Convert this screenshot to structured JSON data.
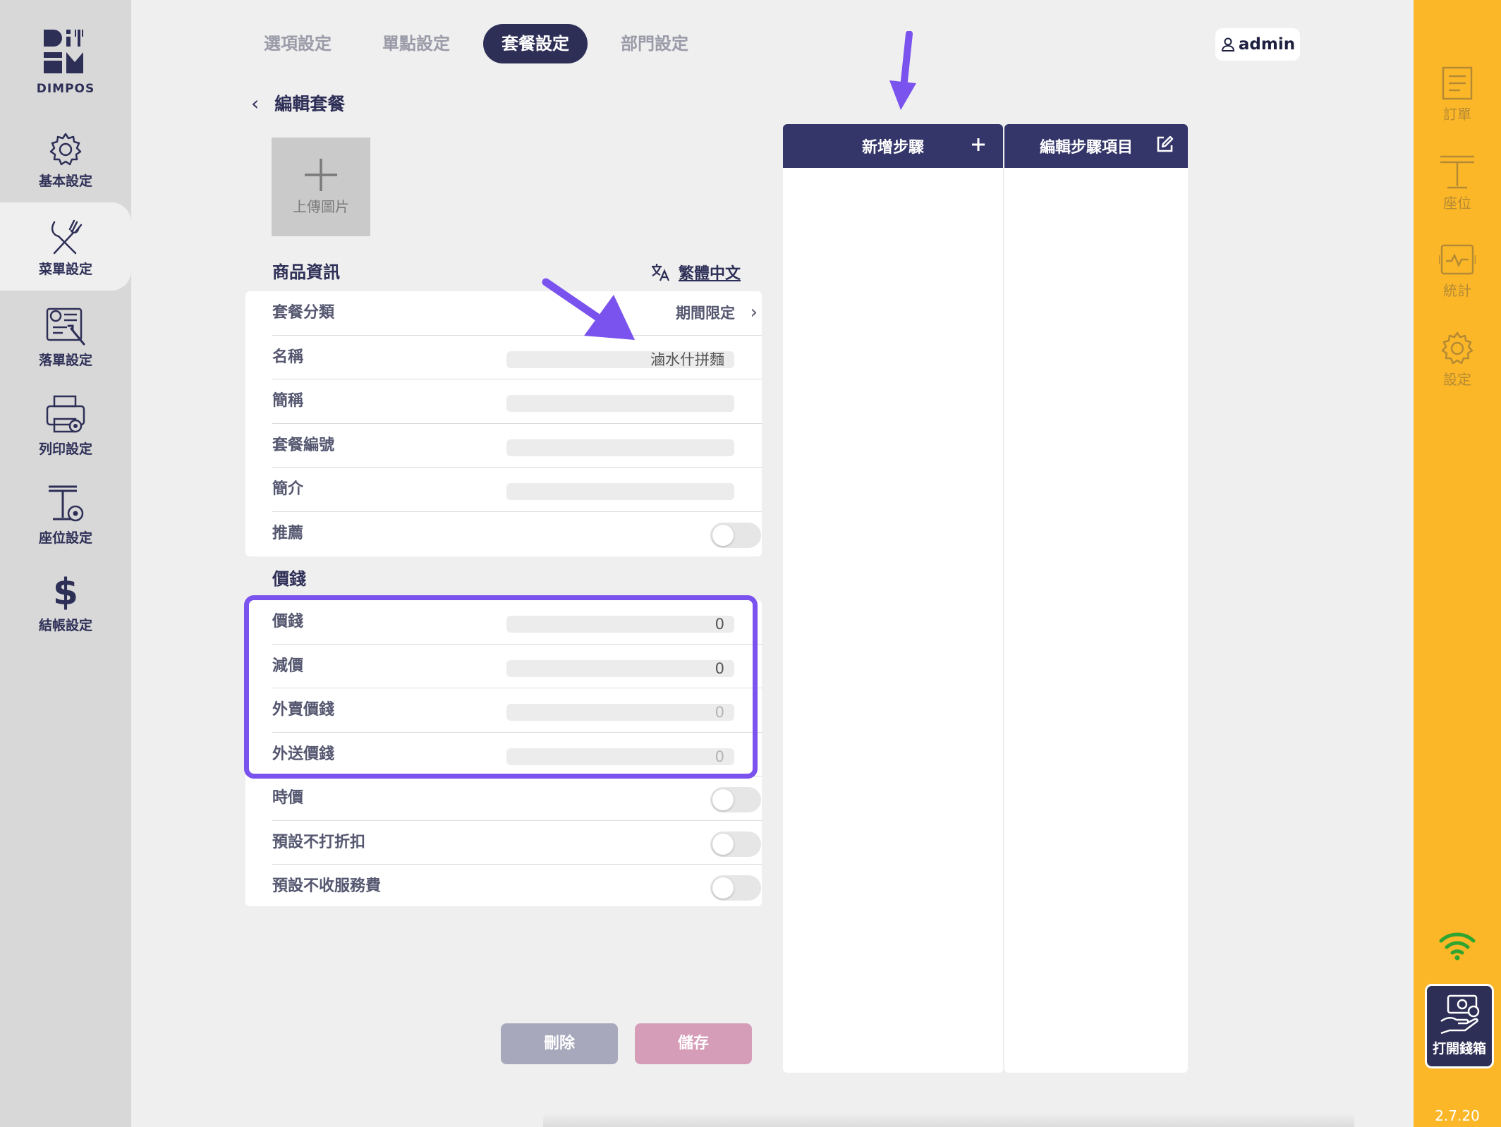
{
  "app": {
    "logo_text": "DIMPOS",
    "version": "2.7.20"
  },
  "left_sidebar": {
    "items": [
      {
        "label": "基本設定",
        "icon": "gear-icon"
      },
      {
        "label": "菜單設定",
        "icon": "fork-knife-icon",
        "active": true
      },
      {
        "label": "落單設定",
        "icon": "order-settings-icon"
      },
      {
        "label": "列印設定",
        "icon": "printer-icon"
      },
      {
        "label": "座位設定",
        "icon": "table-settings-icon"
      },
      {
        "label": "結帳設定",
        "icon": "dollar-icon"
      }
    ]
  },
  "tabs": [
    {
      "label": "選項設定"
    },
    {
      "label": "單點設定"
    },
    {
      "label": "套餐設定",
      "active": true
    },
    {
      "label": "部門設定"
    }
  ],
  "user": {
    "name": "admin"
  },
  "page": {
    "title": "編輯套餐",
    "upload_label": "上傳圖片",
    "product_section_title": "商品資訊",
    "language": "繁體中文"
  },
  "product_info": {
    "category": {
      "label": "套餐分類",
      "value": "期間限定"
    },
    "name": {
      "label": "名稱",
      "value": "滷水什拼麵"
    },
    "short_name": {
      "label": "簡稱",
      "value": ""
    },
    "code": {
      "label": "套餐編號",
      "value": ""
    },
    "description": {
      "label": "簡介",
      "value": ""
    },
    "recommend": {
      "label": "推薦",
      "on": false
    }
  },
  "price_section": {
    "title": "價錢",
    "price": {
      "label": "價錢",
      "value": "0"
    },
    "discount": {
      "label": "減價",
      "value": "0"
    },
    "takeaway_price": {
      "label": "外賣價錢",
      "placeholder": "0"
    },
    "delivery_price": {
      "label": "外送價錢",
      "placeholder": "0"
    },
    "market_price": {
      "label": "時價",
      "on": false
    },
    "no_discount": {
      "label": "預設不打折扣",
      "on": false
    },
    "no_service_charge": {
      "label": "預設不收服務費",
      "on": false
    }
  },
  "buttons": {
    "delete": "刪除",
    "save": "儲存"
  },
  "step_panels": {
    "add_step": "新增步驟",
    "edit_step_items": "編輯步驟項目"
  },
  "right_sidebar": {
    "items": [
      {
        "label": "訂單",
        "icon": "order-list-icon"
      },
      {
        "label": "座位",
        "icon": "seat-icon"
      },
      {
        "label": "統計",
        "icon": "statistics-icon"
      },
      {
        "label": "設定",
        "icon": "settings-gear-icon"
      }
    ],
    "cash_drawer": "打開錢箱"
  },
  "colors": {
    "navy": "#2e2f57",
    "accent_yellow": "#fbb728",
    "highlight_purple": "#7a52ee",
    "delete_button": "#a7a8bb",
    "save_button": "#d69db8",
    "wifi_green": "#2fa52f"
  }
}
